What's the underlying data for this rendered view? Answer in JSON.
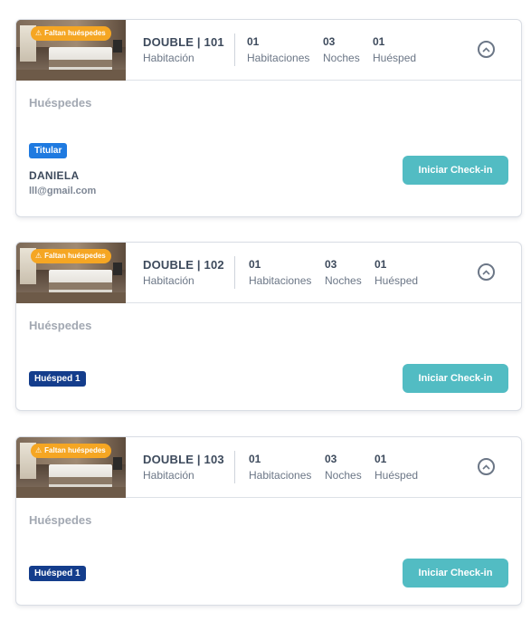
{
  "cards": [
    {
      "warning": "Faltan huéspedes",
      "room_title": "DOUBLE | 101",
      "room_type": "Habitación",
      "rooms_count": "01",
      "rooms_label": "Habitaciones",
      "nights_count": "03",
      "nights_label": "Noches",
      "guests_count": "01",
      "guests_label": "Huésped",
      "section_title": "Huéspedes",
      "badge": "Titular",
      "guest_name": "DANIELA",
      "guest_email": "lll@gmail.com",
      "button_label": "Iniciar Check-in"
    },
    {
      "warning": "Faltan huéspedes",
      "room_title": "DOUBLE | 102",
      "room_type": "Habitación",
      "rooms_count": "01",
      "rooms_label": "Habitaciones",
      "nights_count": "03",
      "nights_label": "Noches",
      "guests_count": "01",
      "guests_label": "Huésped",
      "section_title": "Huéspedes",
      "badge": "Huésped 1",
      "button_label": "Iniciar Check-in"
    },
    {
      "warning": "Faltan huéspedes",
      "room_title": "DOUBLE | 103",
      "room_type": "Habitación",
      "rooms_count": "01",
      "rooms_label": "Habitaciones",
      "nights_count": "03",
      "nights_label": "Noches",
      "guests_count": "01",
      "guests_label": "Huésped",
      "section_title": "Huéspedes",
      "badge": "Huésped 1",
      "button_label": "Iniciar Check-in"
    }
  ],
  "icons": {
    "warning": "warning-icon",
    "collapse": "chevron-up-circle-icon"
  },
  "colors": {
    "warning": "#f5a623",
    "titular": "#1f7ae0",
    "guest_badge": "#143d8c",
    "button": "#52bcc3"
  }
}
